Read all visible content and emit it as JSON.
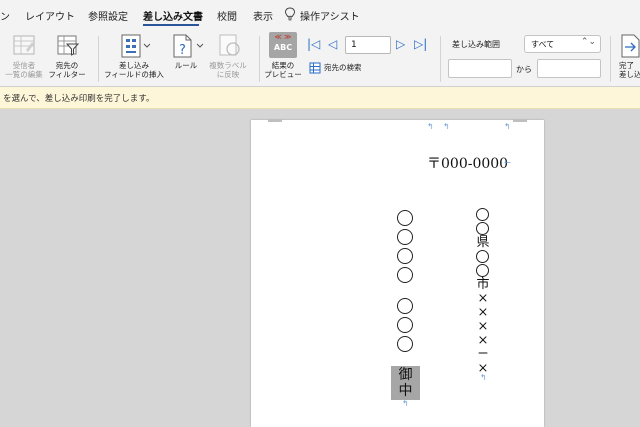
{
  "tabs": [
    {
      "label": "ン"
    },
    {
      "label": "レイアウト"
    },
    {
      "label": "参照設定"
    },
    {
      "label": "差し込み文書",
      "active": true
    },
    {
      "label": "校閲"
    },
    {
      "label": "表示"
    },
    {
      "label": "操作アシスト"
    }
  ],
  "ribbon": {
    "recipients_edit": {
      "line1": "受信者",
      "line2": "一覧の編集"
    },
    "recipient_filter": {
      "line1": "宛先の",
      "line2": "フィルター"
    },
    "insert_field": {
      "line1": "差し込み",
      "line2": "フィールドの挿入"
    },
    "rules": "ルール",
    "multi_label": {
      "line1": "複数ラベル",
      "line2": "に反映"
    },
    "preview_results": {
      "line1": "結果の",
      "line2": "プレビュー"
    },
    "abc": "ABC",
    "record_number": "1",
    "find_recipient": "宛先の検索",
    "range_label": "差し込み範囲",
    "range_value": "すべて",
    "from_label": "から",
    "finish": {
      "line1": "完了",
      "line2": "差し込"
    }
  },
  "message": "を選んで、差し込み印刷を完了します。",
  "document": {
    "postal_code": "〒000-0000",
    "address_chars": [
      "○",
      "○",
      "県",
      "○",
      "○",
      "市",
      "×",
      "×",
      "×",
      "×",
      "ー",
      "×"
    ],
    "name_group1": [
      "○",
      "○",
      "○",
      "○"
    ],
    "name_group2": [
      "○",
      "○",
      "○"
    ],
    "honorific": [
      "御",
      "中"
    ]
  },
  "colors": {
    "accent": "#2b579a",
    "nav_blue": "#2b6cc4",
    "message_bg": "#fdf6d8",
    "highlight": "#a6a6a6"
  },
  "icons": [
    "lightbulb-icon",
    "recipient-list-icon",
    "filter-icon",
    "insert-field-icon",
    "rules-icon",
    "multi-label-icon",
    "preview-abc-icon",
    "first-record-icon",
    "prev-record-icon",
    "next-record-icon",
    "last-record-icon",
    "find-recipient-icon",
    "finish-merge-icon"
  ]
}
